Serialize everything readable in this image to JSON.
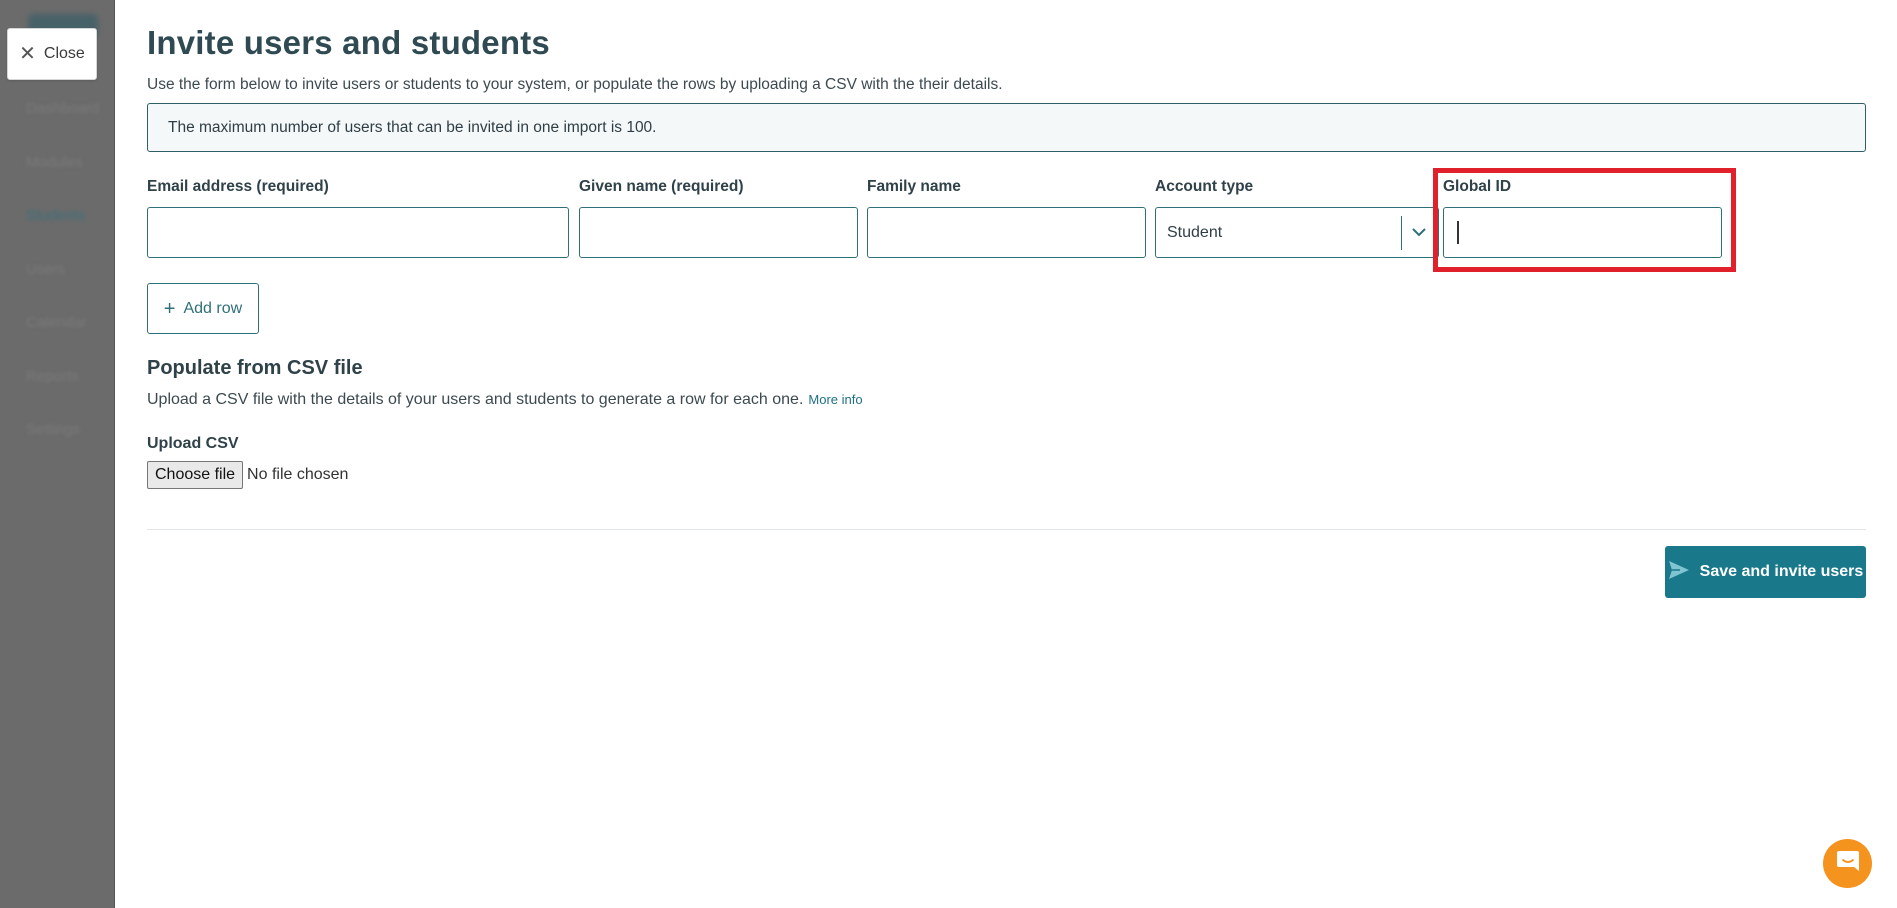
{
  "sidebar": {
    "items": [
      "Dashboard",
      "Modules",
      "Students",
      "Users",
      "Calendar",
      "Reports",
      "Settings"
    ],
    "active_index": 2
  },
  "close_button": {
    "label": "Close"
  },
  "modal": {
    "title": "Invite users and students",
    "subtitle": "Use the form below to invite users or students to your system, or populate the rows by uploading a CSV with the their details.",
    "notice": "The maximum number of users that can be invited in one import is 100."
  },
  "form": {
    "email_label": "Email address (required)",
    "email_value": "",
    "given_label": "Given name (required)",
    "given_value": "",
    "family_label": "Family name",
    "family_value": "",
    "account_type_label": "Account type",
    "account_type_value": "Student",
    "global_id_label": "Global ID",
    "global_id_value": ""
  },
  "add_row": {
    "label": "Add row"
  },
  "csv": {
    "title": "Populate from CSV file",
    "description": "Upload a CSV file with the details of your users and students to generate a row for each one.",
    "more_info": "More info",
    "upload_label": "Upload CSV",
    "choose_file": "Choose file",
    "no_file": "No file chosen"
  },
  "save_button": {
    "label": "Save and invite users"
  },
  "colors": {
    "primary": "#19788a",
    "highlight": "#e0202a",
    "chat": "#f5931f"
  }
}
